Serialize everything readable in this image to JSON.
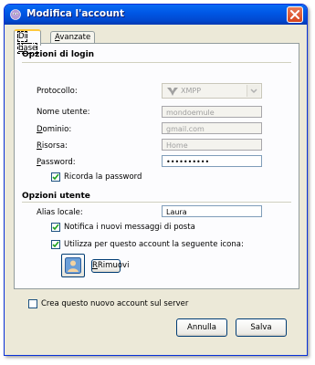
{
  "window": {
    "title": "Modifica l'account",
    "app_icon": "pidgin-icon",
    "close_icon": "close-icon"
  },
  "tabs": [
    {
      "label_pre": "Di ",
      "label_u": "b",
      "label_post": "ase",
      "active": true
    },
    {
      "label_pre": "",
      "label_u": "A",
      "label_post": "vanzate",
      "active": false
    }
  ],
  "login": {
    "heading": "Opzioni di login",
    "protocol_label": "Protocollo:",
    "protocol_value": "XMPP",
    "username_label": "Nome utente:",
    "username_value": "mondoemule",
    "domain_label": "Dominio:",
    "domain_value": "gmail.com",
    "resource_label": "Risorsa:",
    "resource_value": "Home",
    "password_label": "Password:",
    "password_value": "••••••••••",
    "remember_label": "Ricorda la password",
    "remember_checked": true
  },
  "user": {
    "heading": "Opzioni utente",
    "alias_label": "Alias locale:",
    "alias_value": "Laura",
    "notify_label": "Notifica i nuovi messaggi di posta",
    "notify_checked": true,
    "use_icon_label": "Utilizza per questo account la seguente icona:",
    "use_icon_checked": true,
    "remove_label": "Rimuovi"
  },
  "create_on_server_label": "Crea questo nuovo account sul server",
  "create_on_server_checked": false,
  "buttons": {
    "cancel": "Annulla",
    "save": "Salva"
  }
}
